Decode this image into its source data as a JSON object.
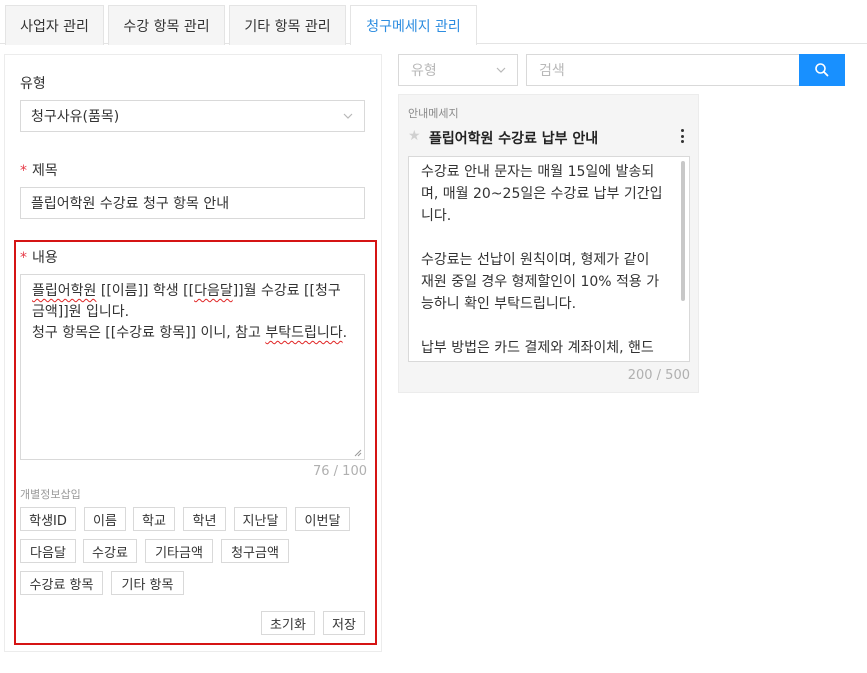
{
  "tabs": [
    {
      "label": "사업자 관리",
      "active": false
    },
    {
      "label": "수강 항목 관리",
      "active": false
    },
    {
      "label": "기타 항목 관리",
      "active": false
    },
    {
      "label": "청구메세지 관리",
      "active": true
    }
  ],
  "form": {
    "type_label": "유형",
    "type_value": "청구사유(품목)",
    "title_required": "*",
    "title_label": "제목",
    "title_value": "플립어학원 수강료 청구 항목 안내",
    "content_required": "*",
    "content_label": "내용",
    "content_line1_a": "플립어학원",
    "content_line1_b": " [[이름]] 학생 [[",
    "content_line1_c": "다음달",
    "content_line1_d": "]]월 수강료 [[청구금액]]원 입니다.",
    "content_line2_a": "청구 항목은 [[수강료 항목]] 이니, 참고 ",
    "content_line2_b": "부탁드립니다",
    "content_line2_c": ".",
    "content_counter": "76 / 100",
    "insert_label": "개별정보삽입",
    "chips": [
      "학생ID",
      "이름",
      "학교",
      "학년",
      "지난달",
      "이번달",
      "다음달",
      "수강료",
      "기타금액",
      "청구금액",
      "수강료 항목",
      "기타 항목"
    ],
    "reset_label": "초기화",
    "save_label": "저장"
  },
  "filter": {
    "type_placeholder": "유형",
    "search_placeholder": "검색"
  },
  "card": {
    "section_label": "안내메세지",
    "title": "플립어학원 수강료 납부 안내",
    "paragraph1": "수강료 안내 문자는 매월 15일에 발송되며, 매월 20~25일은 수강료 납부 기간입니다.",
    "paragraph2": "수강료는 선납이 원칙이며, 형제가 같이 재원 중일 경우 형제할인이 10% 적용 가능하니 확인 부탁드립니다.",
    "paragraph3": "납부 방법은 카드 결제와 계좌이체, 핸드폰 비대면 결제가 가능하며, 계좌이체를 원하",
    "counter": "200 / 500"
  },
  "colors": {
    "accent": "#1890ff",
    "active_tab_text": "#2d8de0",
    "highlight_border": "#d51414",
    "required": "#e63946"
  }
}
